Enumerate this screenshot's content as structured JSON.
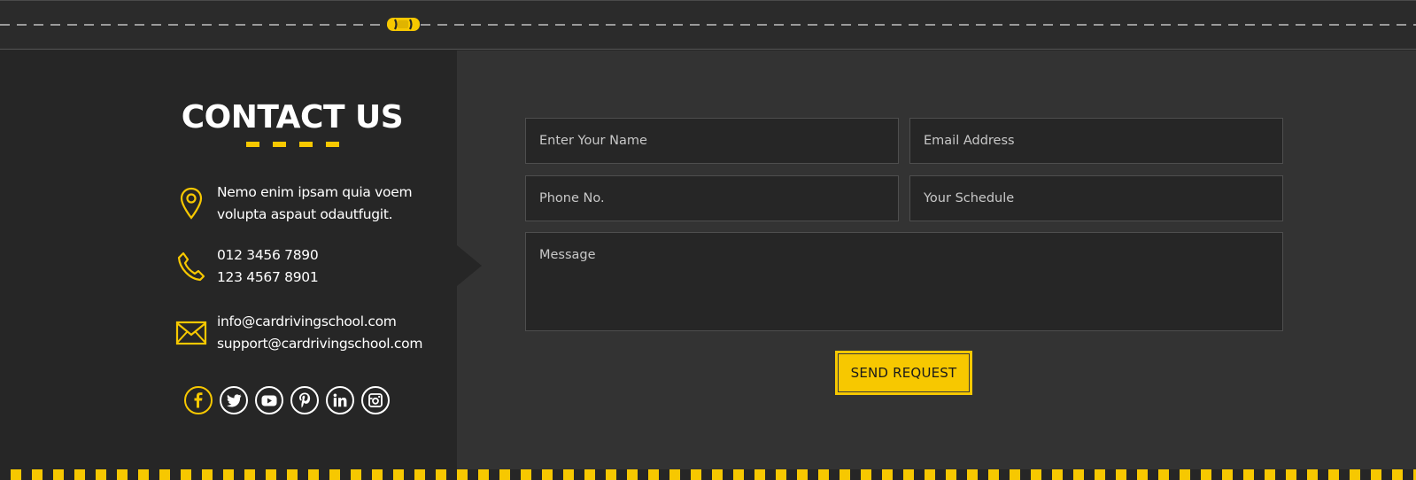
{
  "colors": {
    "accent": "#f7c800",
    "dark_panel": "#262626",
    "form_panel": "#333333",
    "text": "#ffffff"
  },
  "contact": {
    "heading": "CONTACT US",
    "address": {
      "icon": "map-pin-icon",
      "line1": "Nemo enim ipsam quia voem",
      "line2": "volupta aspaut odautfugit."
    },
    "phone": {
      "icon": "phone-icon",
      "line1": "012 3456 7890",
      "line2": "123 4567 8901"
    },
    "email": {
      "icon": "envelope-icon",
      "line1": "info@cardrivingschool.com",
      "line2": "support@cardrivingschool.com"
    },
    "socials": [
      {
        "icon": "facebook-icon",
        "active": true
      },
      {
        "icon": "twitter-icon",
        "active": false
      },
      {
        "icon": "youtube-icon",
        "active": false
      },
      {
        "icon": "pinterest-icon",
        "active": false
      },
      {
        "icon": "linkedin-icon",
        "active": false
      },
      {
        "icon": "instagram-icon",
        "active": false
      }
    ]
  },
  "form": {
    "name_placeholder": "Enter Your Name",
    "email_placeholder": "Email Address",
    "phone_placeholder": "Phone No.",
    "schedule_placeholder": "Your Schedule",
    "message_placeholder": "Message",
    "submit_label": "SEND REQUEST"
  },
  "decor": {
    "car_icon": "car-icon"
  }
}
